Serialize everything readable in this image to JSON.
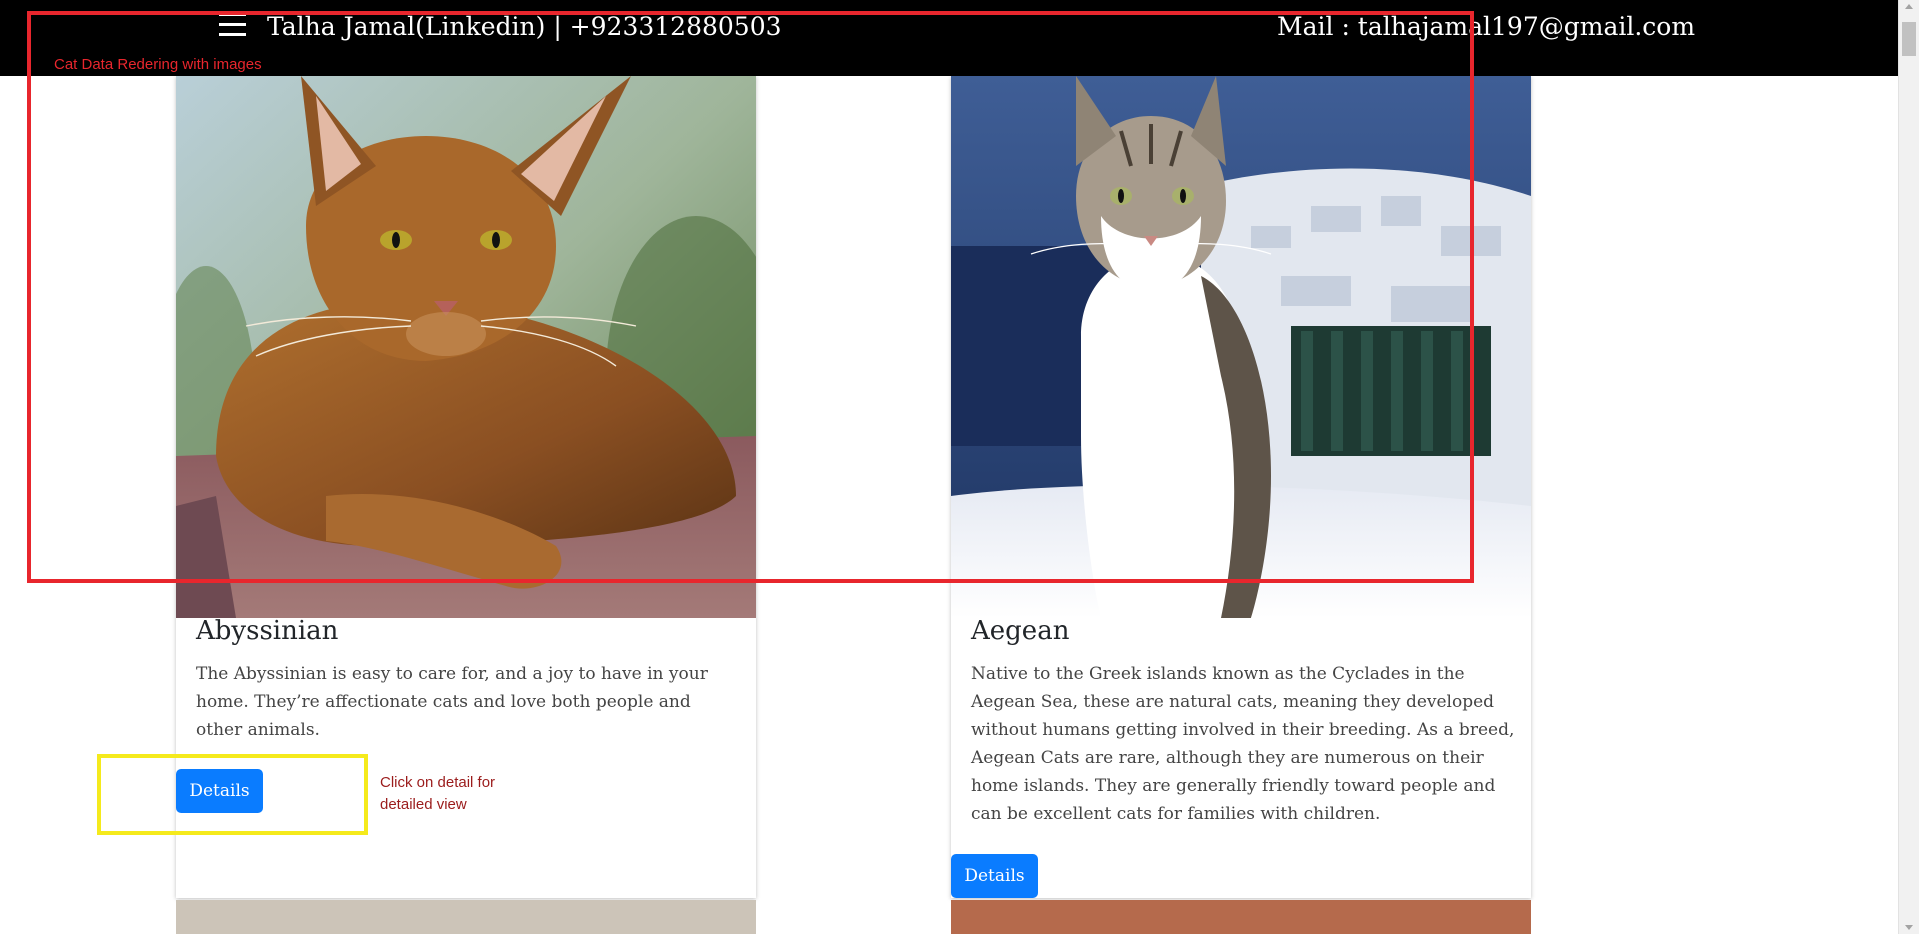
{
  "navbar": {
    "menu_icon": "hamburger-icon",
    "brand": "Talha Jamal(Linkedin) | +923312880503",
    "mail": "Mail : talhajamal197@gmail.com",
    "background": "#000000"
  },
  "cards": [
    {
      "image_alt": "Abyssinian cat",
      "title": "Abyssinian",
      "description": "The Abyssinian is easy to care for, and a joy to have in your home. They’re affectionate cats and love both people and other animals.",
      "button_label": "Details"
    },
    {
      "image_alt": "Aegean cat",
      "title": "Aegean",
      "description": "Native to the Greek islands known as the Cyclades in the Aegean Sea, these are natural cats, meaning they developed without humans getting involved in their breeding. As a breed, Aegean Cats are rare, although they are numerous on their home islands. They are generally friendly toward people and can be excellent cats for families with children.",
      "button_label": "Details"
    }
  ],
  "annotations": {
    "red_box_label": "Cat Data Redering with images",
    "yellow_box_label": "Click on detail for detailed view",
    "red_color": "#e8262d",
    "yellow_color": "#f5ea1c"
  },
  "theme": {
    "button_color": "#0a7cff"
  }
}
